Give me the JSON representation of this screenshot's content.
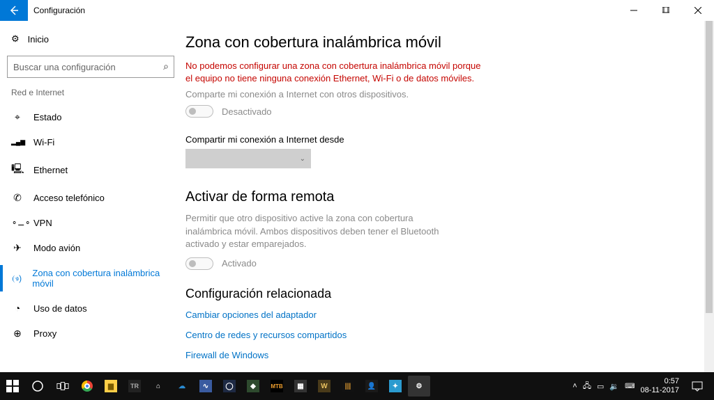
{
  "titlebar": {
    "title": "Configuración"
  },
  "sidebar": {
    "home": "Inicio",
    "search_placeholder": "Buscar una configuración",
    "category": "Red e Internet",
    "items": [
      {
        "icon": "⌖",
        "label": "Estado"
      },
      {
        "icon": "▂▄▆",
        "label": "Wi-Fi"
      },
      {
        "icon": "🖳",
        "label": "Ethernet"
      },
      {
        "icon": "✆",
        "label": "Acceso telefónico"
      },
      {
        "icon": "∾",
        "label": "VPN"
      },
      {
        "icon": "✈",
        "label": "Modo avión"
      },
      {
        "icon": "(ෳ)",
        "label": "Zona con cobertura inalámbrica móvil"
      },
      {
        "icon": "◔",
        "label": "Uso de datos"
      },
      {
        "icon": "⊕",
        "label": "Proxy"
      }
    ]
  },
  "main": {
    "h1": "Zona con cobertura inalámbrica móvil",
    "error": "No podemos configurar una zona con cobertura inalámbrica móvil porque el equipo no tiene ninguna conexión Ethernet, Wi-Fi o de datos móviles.",
    "share_desc": "Comparte mi conexión a Internet con otros dispositivos.",
    "share_toggle": "Desactivado",
    "share_from_label": "Compartir mi conexión a Internet desde",
    "remote_h": "Activar de forma remota",
    "remote_desc": "Permitir que otro dispositivo active la zona con cobertura inalámbrica móvil. Ambos dispositivos deben tener el Bluetooth activado y estar emparejados.",
    "remote_toggle": "Activado",
    "related_h": "Configuración relacionada",
    "links": [
      "Cambiar opciones del adaptador",
      "Centro de redes y recursos compartidos",
      "Firewall de Windows"
    ]
  },
  "taskbar": {
    "time": "0:57",
    "date": "08-11-2017"
  }
}
